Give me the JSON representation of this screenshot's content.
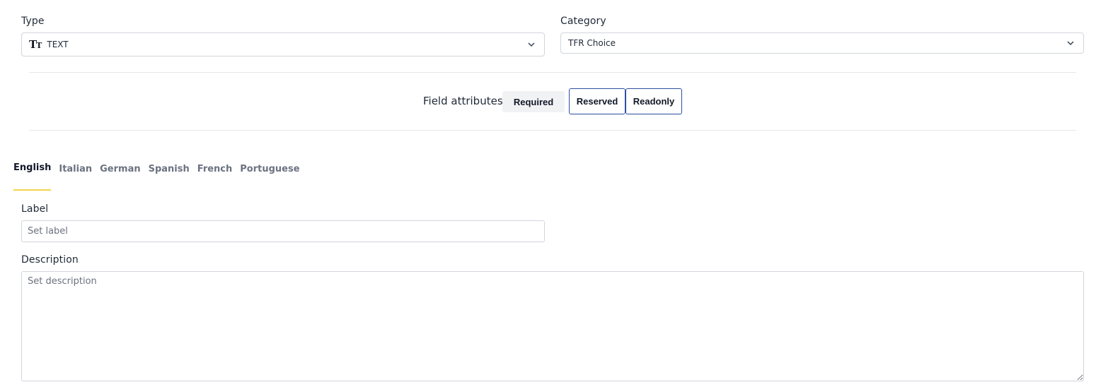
{
  "type_field": {
    "label": "Type",
    "value": "TEXT",
    "icon": "text-type-icon",
    "icon_glyph_big": "T",
    "icon_glyph_small": "T"
  },
  "category_field": {
    "label": "Category",
    "value": "TFR Choice"
  },
  "attributes": {
    "title": "Field attributes",
    "buttons": [
      "Required",
      "Reserved",
      "Readonly"
    ]
  },
  "tabs": [
    "English",
    "Italian",
    "German",
    "Spanish",
    "French",
    "Portuguese"
  ],
  "label_field": {
    "label": "Label",
    "placeholder": "Set label"
  },
  "description_field": {
    "label": "Description",
    "placeholder": "Set description"
  },
  "colors": {
    "accent_underline": "#f5d34a",
    "button_border": "#2b4fa0"
  }
}
